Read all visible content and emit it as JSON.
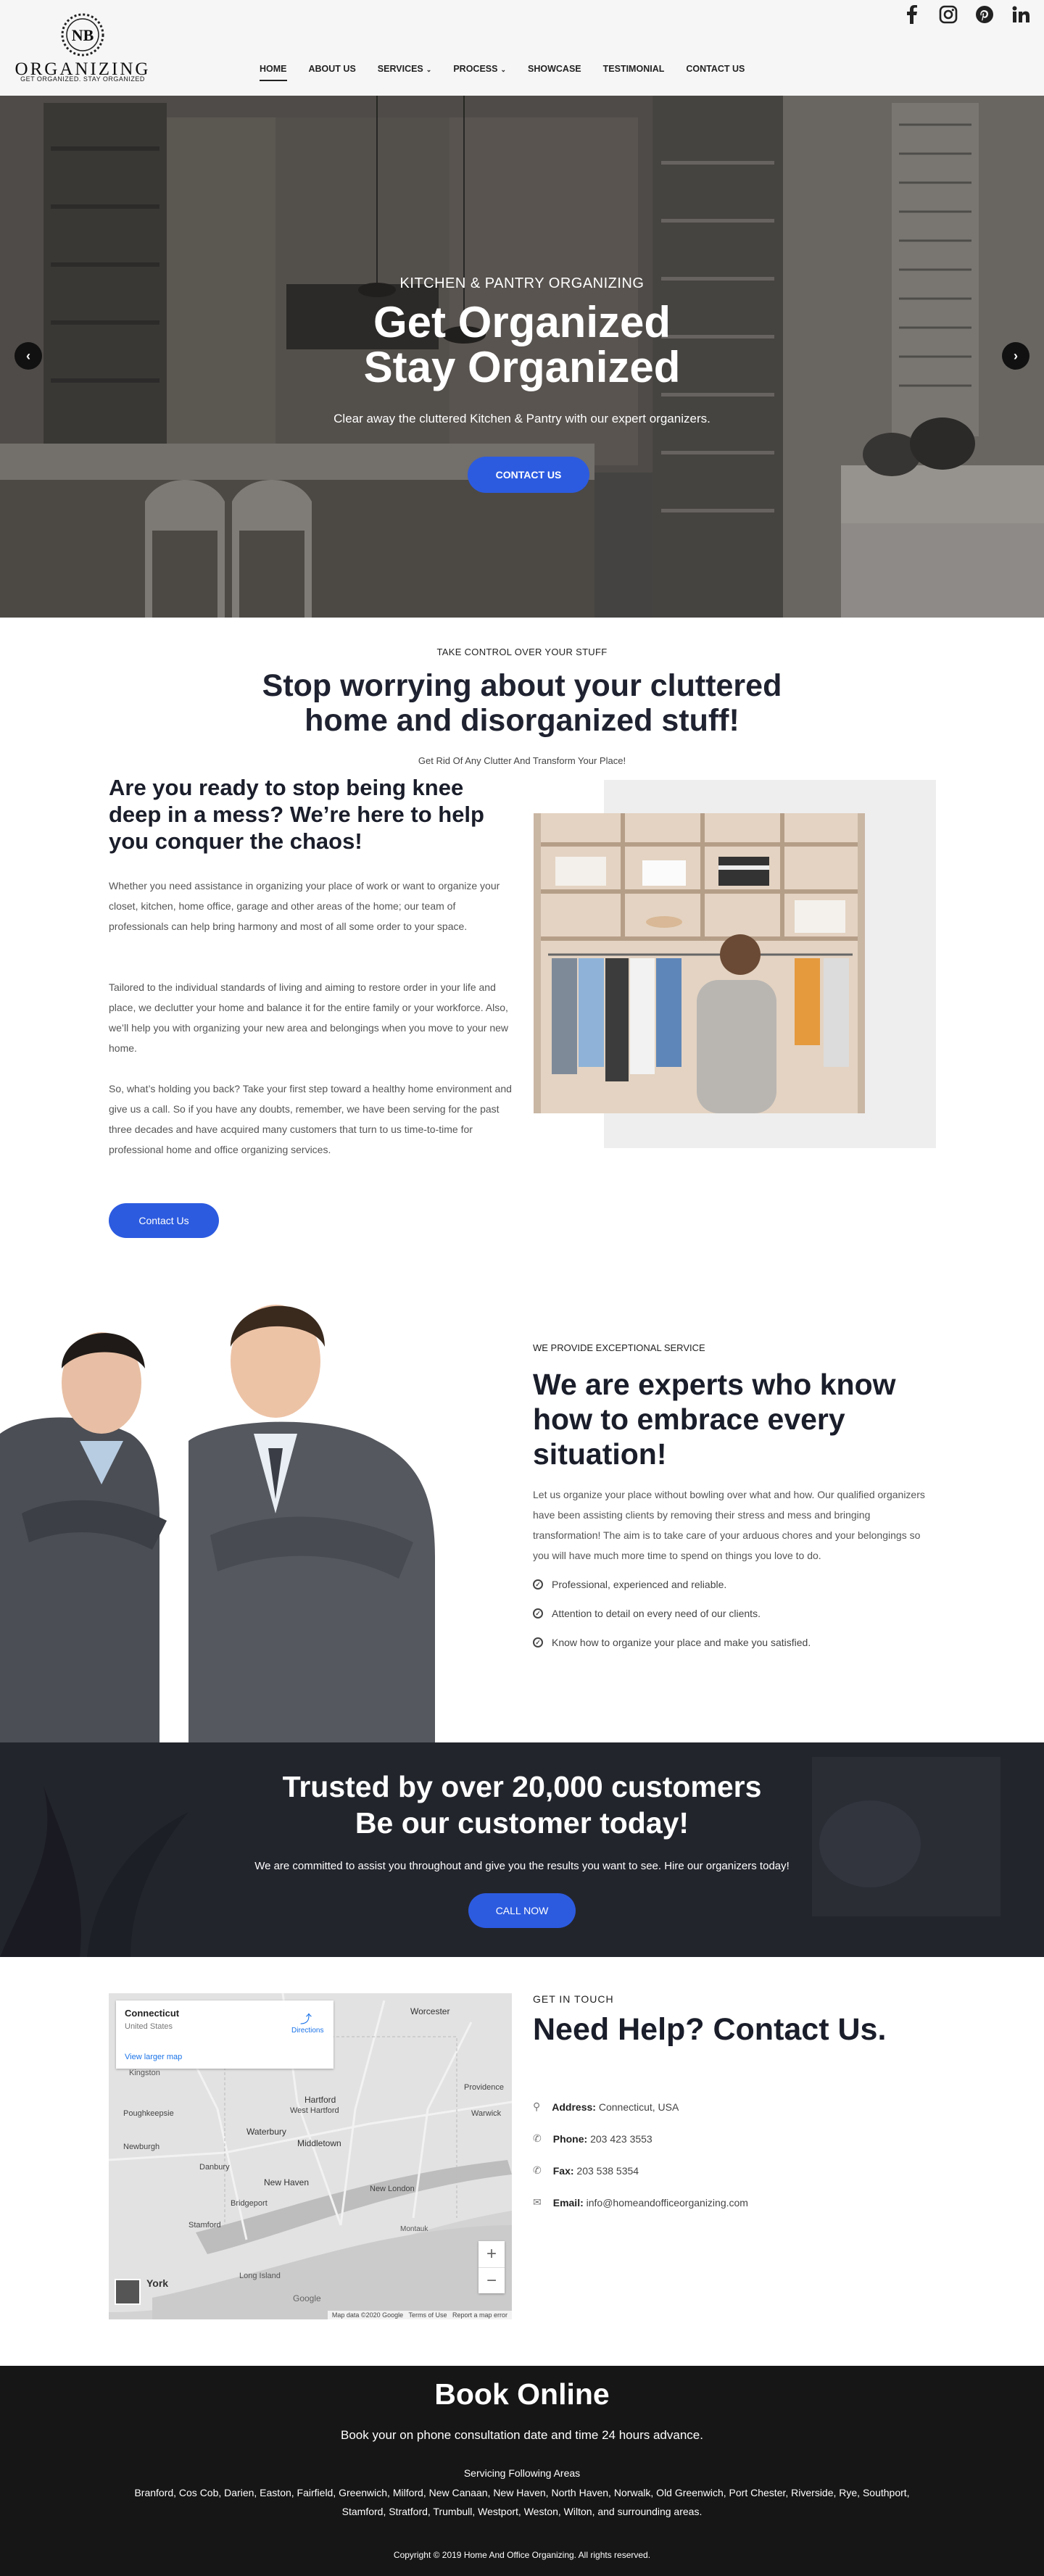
{
  "header": {
    "logo_monogram": "NB",
    "logo_word": "ORGANIZING",
    "logo_tagline": "GET ORGANIZED. STAY ORGANIZED",
    "nav": [
      {
        "label": "HOME",
        "active": true,
        "has_caret": false
      },
      {
        "label": "ABOUT US",
        "active": false,
        "has_caret": false
      },
      {
        "label": "SERVICES",
        "active": false,
        "has_caret": true
      },
      {
        "label": "PROCESS",
        "active": false,
        "has_caret": true
      },
      {
        "label": "SHOWCASE",
        "active": false,
        "has_caret": false
      },
      {
        "label": "TESTIMONIAL",
        "active": false,
        "has_caret": false
      },
      {
        "label": "CONTACT US",
        "active": false,
        "has_caret": false
      }
    ],
    "socials": [
      "facebook-icon",
      "instagram-icon",
      "pinterest-icon",
      "linkedin-icon"
    ]
  },
  "hero": {
    "kicker": "KITCHEN & PANTRY ORGANIZING",
    "title_line1": "Get Organized",
    "title_line2": "Stay Organized",
    "subtitle": "Clear away the cluttered Kitchen & Pantry with our expert organizers.",
    "button": "CONTACT US"
  },
  "intro": {
    "kicker": "TAKE CONTROL OVER YOUR STUFF",
    "title_line1": "Stop worrying about your cluttered",
    "title_line2": "home and disorganized stuff!",
    "subtitle": "Get Rid Of Any Clutter And Transform Your Place!",
    "heading": "Are you ready to stop being knee deep in a mess? We’re here to help you conquer the chaos!",
    "paragraphs": [
      "Whether you need assistance in organizing your place of work or want to organize your closet, kitchen, home office, garage and other areas of the home; our team of professionals can help bring harmony and most of all some order to your space.",
      "Tailored to the individual standards of living and aiming to restore order in your life and place, we declutter your home and balance it for the entire family or your workforce. Also, we’ll help you with organizing your new area and belongings when you move to your new home.",
      "So, what’s holding you back? Take your first step toward a healthy home environment and give us a call. So if you have any doubts, remember, we have been serving for the past three decades and have acquired many customers that turn to us time-to-time for professional home and office organizing services."
    ],
    "button": "Contact Us"
  },
  "experts": {
    "kicker": "WE PROVIDE EXCEPTIONAL SERVICE",
    "title": "We are experts who know how to embrace every situation!",
    "paragraph": "Let us organize your place without bowling over what and how. Our qualified organizers have been assisting clients by removing their stress and mess and bringing transformation! The aim is to take care of your arduous chores and your belongings so you will have much more time to spend on things you love to do.",
    "checks": [
      "Professional, experienced and reliable.",
      "Attention to detail on every need of our clients.",
      "Know how to organize your place and make you satisfied."
    ]
  },
  "trusted": {
    "title_line1": "Trusted by over 20,000 customers",
    "title_line2": "Be our customer today!",
    "subtitle": "We are committed to assist you throughout and give you the results you want to see. Hire our organizers today!",
    "button": "CALL NOW"
  },
  "contact": {
    "map": {
      "place": "Connecticut",
      "country": "United States",
      "directions": "Directions",
      "view_larger": "View larger map",
      "labels": [
        "Worcester",
        "Kingston",
        "Hartford",
        "West Hartford",
        "Poughkeepsie",
        "Waterbury",
        "Middletown",
        "Newburgh",
        "Danbury",
        "New Haven",
        "New London",
        "Providence",
        "Warwick",
        "Bridgeport",
        "Stamford",
        "Long Island",
        "York",
        "Montauk"
      ],
      "attribution": "Map data ©2020 Google   Terms of Use   Report a map error",
      "google": "Google",
      "zoom_in": "+",
      "zoom_out": "−"
    },
    "kicker": "GET IN TOUCH",
    "title": "Need Help? Contact Us.",
    "items": [
      {
        "icon": "location-pin-icon",
        "label": "Address:",
        "value": "Connecticut, USA"
      },
      {
        "icon": "phone-icon",
        "label": "Phone:",
        "value": "203 423 3553"
      },
      {
        "icon": "fax-icon",
        "label": "Fax:",
        "value": "203 538 5354"
      },
      {
        "icon": "email-icon",
        "label": "Email:",
        "value": "info@homeandofficeorganizing.com"
      }
    ]
  },
  "footer": {
    "title": "Book Online",
    "subtitle": "Book your on phone consultation date and time 24 hours advance.",
    "areas_heading": "Servicing Following Areas",
    "areas": "Branford, Cos Cob, Darien, Easton, Fairfield, Greenwich, Milford, New Canaan, New Haven, North Haven, Norwalk, Old Greenwich, Port Chester, Riverside, Rye, Southport, Stamford, Stratford, Trumbull, Westport, Weston, Wilton, and surrounding areas.",
    "copyright": "Copyright © 2019 Home And Office Organizing. All rights reserved."
  },
  "colors": {
    "accent": "#2c5be0",
    "heading": "#1a1d2a",
    "dark_band": "#2b2d36",
    "footer": "#161616"
  }
}
